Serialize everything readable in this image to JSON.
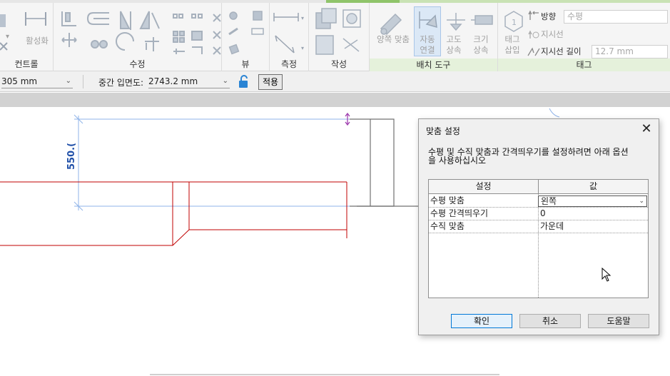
{
  "ribbon": {
    "panels": {
      "control": "컨트롤",
      "modify": "수정",
      "view": "뷰",
      "measure": "측정",
      "create": "작성",
      "placement_tools": "배치 도구",
      "tag": "태그"
    },
    "tools": {
      "activate": "활성화",
      "align_both": "양쪽 맞춤",
      "auto_connect_1": "자동",
      "auto_connect_2": "연결",
      "elevation_up_1": "고도",
      "elevation_up_2": "상속",
      "size_up_1": "크기",
      "size_up_2": "상속",
      "tag_insert_1": "태그",
      "tag_insert_2": "삽입",
      "orientation_label": "방향",
      "orientation_value": "수평",
      "leader": "지시선",
      "leader_length_label": "지시선 길이",
      "leader_length_value": "12.7 mm"
    }
  },
  "options_bar": {
    "offset_value": "305 mm",
    "middle_elevation_label": "중간 입면도:",
    "middle_elevation_value": "2743.2 mm",
    "apply_button": "적용"
  },
  "canvas": {
    "dimension_text": "550.("
  },
  "dialog": {
    "title": "맞춤 설정",
    "description_line1": "수평 및 수직 맞춤과 간격띄우기를 설정하려면 아래 옵션",
    "description_line2": "을 사용하십시오",
    "columns": [
      "설정",
      "값"
    ],
    "rows": [
      {
        "setting": "수평 맞춤",
        "value": "왼쪽"
      },
      {
        "setting": "수평 간격띄우기",
        "value": "0"
      },
      {
        "setting": "수직 맞춤",
        "value": "가운데"
      }
    ],
    "buttons": {
      "ok": "확인",
      "cancel": "취소",
      "help": "도움말"
    }
  },
  "colors": {
    "accent_blue": "#0078d7",
    "pipe_red": "#c00000",
    "dimension_blue": "#1f4fa8",
    "ribbon_green": "#8fc46a"
  }
}
